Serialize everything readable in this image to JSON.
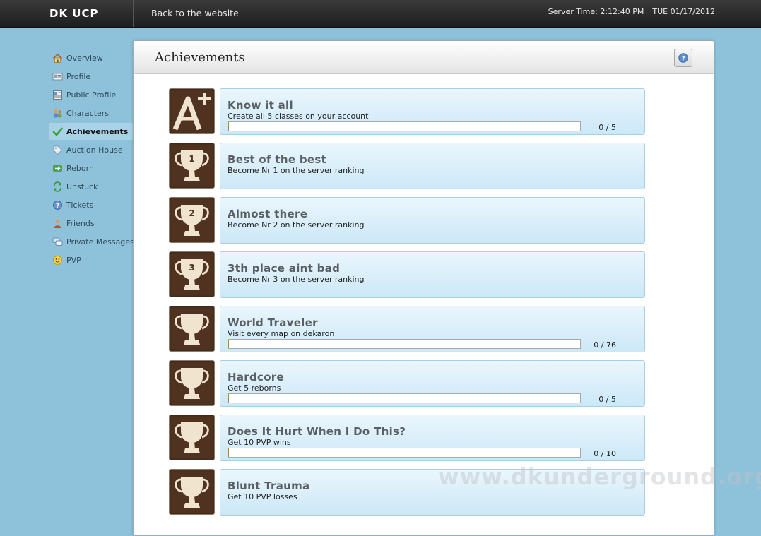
{
  "brand": "DK UCP",
  "topbar": {
    "back_link": "Back to the website",
    "server_time": "Server Time: 2:12:40 PM",
    "date": "TUE 01/17/2012"
  },
  "sidebar": {
    "items": [
      {
        "label": "Overview",
        "icon": "home-icon"
      },
      {
        "label": "Profile",
        "icon": "profile-card-icon"
      },
      {
        "label": "Public Profile",
        "icon": "public-profile-icon"
      },
      {
        "label": "Characters",
        "icon": "characters-icon"
      },
      {
        "label": "Achievements",
        "icon": "checkmark-icon",
        "active": true
      },
      {
        "label": "Auction House",
        "icon": "tag-icon"
      },
      {
        "label": "Reborn",
        "icon": "reborn-icon"
      },
      {
        "label": "Unstuck",
        "icon": "refresh-icon"
      },
      {
        "label": "Tickets",
        "icon": "help-icon"
      },
      {
        "label": "Friends",
        "icon": "friends-icon"
      },
      {
        "label": "Private Messages",
        "icon": "messages-icon"
      },
      {
        "label": "PVP",
        "icon": "smiley-icon"
      }
    ]
  },
  "panel": {
    "title": "Achievements"
  },
  "achievements": [
    {
      "title": "Know it all",
      "description": "Create all 5 classes on your account",
      "count": "0 / 5",
      "progress": 0,
      "icon": "a-plus-icon"
    },
    {
      "title": "Best of the best",
      "description": "Become Nr 1 on the server ranking",
      "icon": "trophy-icon",
      "rank": "1"
    },
    {
      "title": "Almost there",
      "description": "Become Nr 2 on the server ranking",
      "icon": "trophy-icon",
      "rank": "2"
    },
    {
      "title": "3th place aint bad",
      "description": "Become Nr 3 on the server ranking",
      "icon": "trophy-icon",
      "rank": "3"
    },
    {
      "title": "World Traveler",
      "description": "Visit every map on dekaron",
      "count": "0 / 76",
      "progress": 0,
      "icon": "trophy-icon"
    },
    {
      "title": "Hardcore",
      "description": "Get 5 reborns",
      "count": "0 / 5",
      "progress": 0,
      "icon": "trophy-icon"
    },
    {
      "title": "Does It Hurt When I Do This?",
      "description": "Get 10 PVP wins",
      "count": "0 / 10",
      "progress": 0,
      "icon": "trophy-icon"
    },
    {
      "title": "Blunt Trauma",
      "description": "Get 10 PVP losses",
      "icon": "trophy-icon"
    }
  ],
  "watermark": "www.dkunderground.org",
  "colors": {
    "background": "#8ec2da",
    "topbar": "#2a2a2a",
    "icon_bg": "#4f3320",
    "trophy": "#f0e4cf",
    "card": "#d6eefa"
  }
}
